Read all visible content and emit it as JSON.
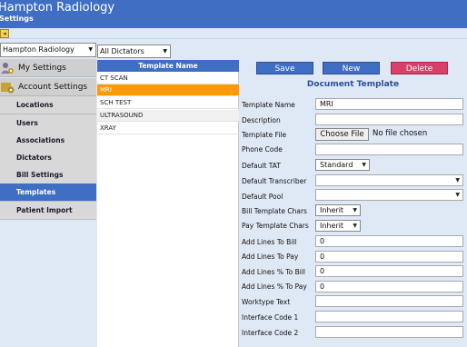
{
  "header": {
    "app_title": "Hampton Radiology",
    "subtitle": "Settings"
  },
  "toolbar": {
    "back_icon": "back-arrow-icon"
  },
  "sidebar": {
    "facility_select": "Hampton Radiology",
    "my_settings_label": "My Settings",
    "account_settings_label": "Account Settings",
    "items": [
      {
        "label": "Locations"
      },
      {
        "label": "Users"
      },
      {
        "label": "Associations"
      },
      {
        "label": "Dictators"
      },
      {
        "label": "Bill Settings"
      },
      {
        "label": "Templates",
        "active": true
      },
      {
        "label": "Patient Import"
      }
    ]
  },
  "dictator_filter": "All Dictators",
  "template_list": {
    "header": "Template Name",
    "rows": [
      "CT SCAN",
      "MRI",
      "SCH TEST",
      "ULTRASOUND",
      "XRAY"
    ],
    "selected": "MRI"
  },
  "form": {
    "buttons": {
      "save": "Save",
      "new": "New",
      "delete": "Delete"
    },
    "title": "Document Template",
    "labels": {
      "template_name": "Template Name",
      "description": "Description",
      "template_file": "Template File",
      "phone_code": "Phone Code",
      "default_tat": "Default TAT",
      "default_transcriber": "Default Transcriber",
      "default_pool": "Default Pool",
      "bill_template_chars": "Bill Template Chars",
      "pay_template_chars": "Pay Template Chars",
      "add_lines_to_bill": "Add Lines To Bill",
      "add_lines_to_pay": "Add Lines To Pay",
      "add_lines_pct_bill": "Add Lines % To Bill",
      "add_lines_pct_pay": "Add Lines % To Pay",
      "worktype_text": "Worktype Text",
      "interface_code_1": "Interface Code 1",
      "interface_code_2": "Interface Code 2"
    },
    "values": {
      "template_name": "MRI",
      "description": "",
      "choose_file": "Choose File",
      "file_status": "No file chosen",
      "phone_code": "",
      "default_tat": "Standard",
      "default_transcriber": "",
      "default_pool": "",
      "bill_template_chars": "Inherit",
      "pay_template_chars": "Inherit",
      "add_lines_to_bill": "0",
      "add_lines_to_pay": "0",
      "add_lines_pct_bill": "0",
      "add_lines_pct_pay": "0",
      "worktype_text": "",
      "interface_code_1": "",
      "interface_code_2": ""
    }
  },
  "colors": {
    "header": "#3f6ec3",
    "selected_row": "#ff9b00",
    "delete": "#d83f69",
    "background": "#dfe8f5"
  }
}
